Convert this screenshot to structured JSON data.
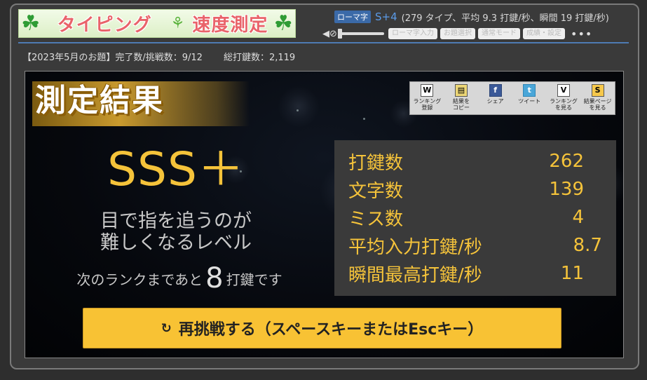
{
  "header": {
    "logo_text_1": "タイピング",
    "logo_text_2": "速度測定",
    "clover_glyph": "☘",
    "sprout_glyph": "⚘",
    "mode_badge": "ローマ字",
    "current_rank": "S+4",
    "rank_detail": "(279 タイプ、平均 9.3 打鍵/秒、瞬間 19 打鍵/秒)",
    "volume_icon": "speaker-muted-icon",
    "volume_glyph": "◀⊘",
    "volume_level": 0,
    "buttons": [
      "ローマ字入力",
      "お題選択",
      "通常モード",
      "成績・設定"
    ],
    "more_label": "•••"
  },
  "stats": {
    "topic": "【2023年5月のお題】完了数/挑戦数：9/12",
    "total_keystrokes": "総打鍵数：2,119"
  },
  "result": {
    "title": "測定結果",
    "share": [
      {
        "icon": "W",
        "label": "ランキング\n登録"
      },
      {
        "icon": "▤",
        "label": "結果を\nコピー"
      },
      {
        "icon": "f",
        "label": "シェア"
      },
      {
        "icon": "t",
        "label": "ツイート"
      },
      {
        "icon": "V",
        "label": "ランキング\nを見る"
      },
      {
        "icon": "S",
        "label": "結果ページ\nを見る"
      }
    ],
    "rank": "SSS＋",
    "rank_desc_1": "目で指を追うのが",
    "rank_desc_2": "難しくなるレベル",
    "next_prefix": "次のランクまであと",
    "next_count": "8",
    "next_suffix": "打鍵です",
    "scores": [
      {
        "label": "打鍵数",
        "value": "262"
      },
      {
        "label": "文字数",
        "value": "139"
      },
      {
        "label": "ミス数",
        "value": "4"
      },
      {
        "label": "平均入力打鍵/秒",
        "value": "8.7"
      },
      {
        "label": "瞬間最高打鍵/秒",
        "value": "11"
      }
    ],
    "retry_icon": "↻",
    "retry_label": "再挑戦する（スペースキーまたはEscキー）"
  },
  "colors": {
    "accent_gold": "#f5c33a",
    "rank_blue": "#5b9be8",
    "divider_blue": "#4e7bb3",
    "retry_bg": "#f8c234"
  }
}
